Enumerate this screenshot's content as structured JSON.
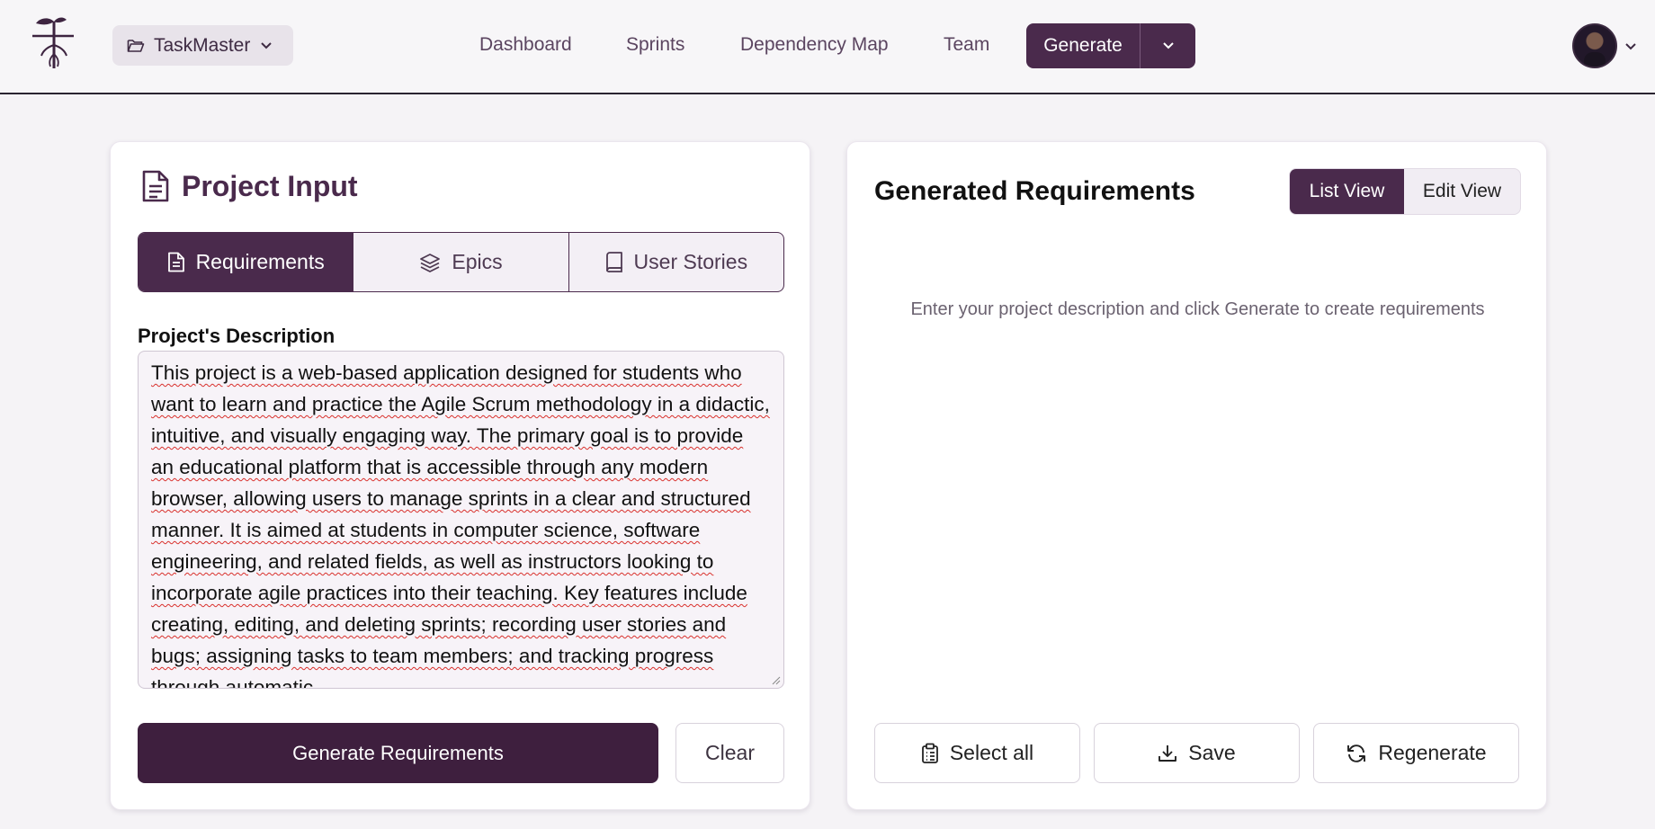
{
  "header": {
    "project_name": "TaskMaster",
    "nav": [
      "Dashboard",
      "Sprints",
      "Dependency Map",
      "Team"
    ],
    "generate_label": "Generate"
  },
  "project_input": {
    "title": "Project Input",
    "tabs": [
      {
        "label": "Requirements",
        "icon": "file-text-icon",
        "active": true
      },
      {
        "label": "Epics",
        "icon": "layers-icon",
        "active": false
      },
      {
        "label": "User Stories",
        "icon": "book-icon",
        "active": false
      }
    ],
    "description_label": "Project's Description",
    "description_value": "This project is a web-based application designed for students who want to learn and practice the Agile Scrum methodology in a didactic, intuitive, and visually engaging way. The primary goal is to provide an educational platform that is accessible through any modern browser, allowing users to manage sprints in a clear and structured manner. It is aimed at students in computer science, software engineering, and related fields, as well as instructors looking to incorporate agile practices into their teaching. Key features include creating, editing, and deleting sprints; recording user stories and bugs; assigning tasks to team members; and tracking progress through automatic",
    "generate_button": "Generate Requirements",
    "clear_button": "Clear"
  },
  "generated": {
    "title": "Generated Requirements",
    "view_list": "List View",
    "view_edit": "Edit View",
    "empty_message": "Enter your project description and click Generate to create requirements",
    "select_all": "Select all",
    "save": "Save",
    "regenerate": "Regenerate"
  },
  "colors": {
    "brand": "#4a2a4c",
    "brand_dark": "#3e1f3e",
    "background": "#f5f3f6"
  }
}
